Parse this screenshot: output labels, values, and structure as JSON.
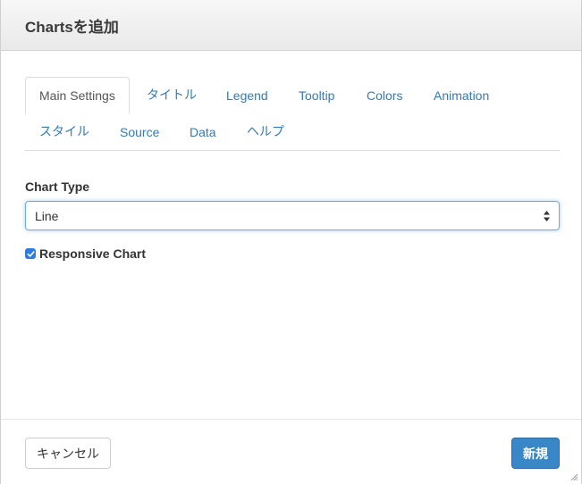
{
  "dialog": {
    "title": "Chartsを追加"
  },
  "tabs": [
    {
      "label": "Main Settings",
      "active": true
    },
    {
      "label": "タイトル"
    },
    {
      "label": "Legend"
    },
    {
      "label": "Tooltip"
    },
    {
      "label": "Colors"
    },
    {
      "label": "Animation"
    },
    {
      "label": "スタイル"
    },
    {
      "label": "Source"
    },
    {
      "label": "Data"
    },
    {
      "label": "ヘルプ"
    }
  ],
  "form": {
    "chart_type_label": "Chart Type",
    "chart_type_value": "Line",
    "responsive_label": "Responsive Chart",
    "responsive_checked": true
  },
  "footer": {
    "cancel_label": "キャンセル",
    "create_label": "新規"
  },
  "colors": {
    "link": "#337ab7",
    "primary": "#3a87c8",
    "checkbox": "#2f7be5",
    "focus": "#66afe9"
  }
}
